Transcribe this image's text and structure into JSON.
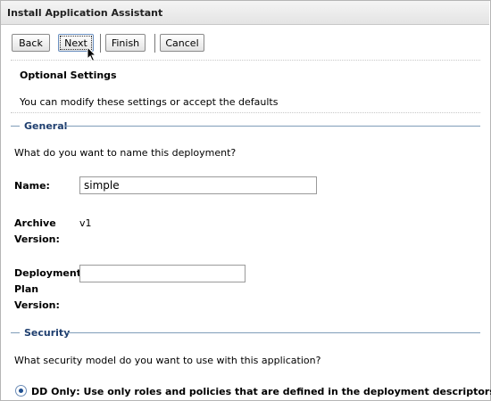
{
  "window": {
    "title": "Install Application Assistant"
  },
  "toolbar": {
    "back_label": "Back",
    "next_label": "Next",
    "finish_label": "Finish",
    "cancel_label": "Cancel"
  },
  "intro": {
    "heading": "Optional Settings",
    "description": "You can modify these settings or accept the defaults"
  },
  "general": {
    "section_title": "General",
    "question": "What do you want to name this deployment?",
    "name_label": "Name:",
    "name_value": "simple",
    "archive_version_label_1": "Archive",
    "archive_version_label_2": "Version:",
    "archive_version_value": "v1",
    "plan_version_label_1": "Deployment",
    "plan_version_label_2": "Plan",
    "plan_version_label_3": "Version:",
    "plan_version_value": ""
  },
  "security": {
    "section_title": "Security",
    "question": "What security model do you want to use with this application?",
    "option_dd_only": "DD Only: Use only roles and policies that are defined in the deployment descriptors."
  },
  "icons": {
    "cursor": "mouse-pointer-icon",
    "radio": "radio-selected-icon"
  },
  "colors": {
    "section_title": "#1f3f6f",
    "section_line": "#7f9db9"
  }
}
